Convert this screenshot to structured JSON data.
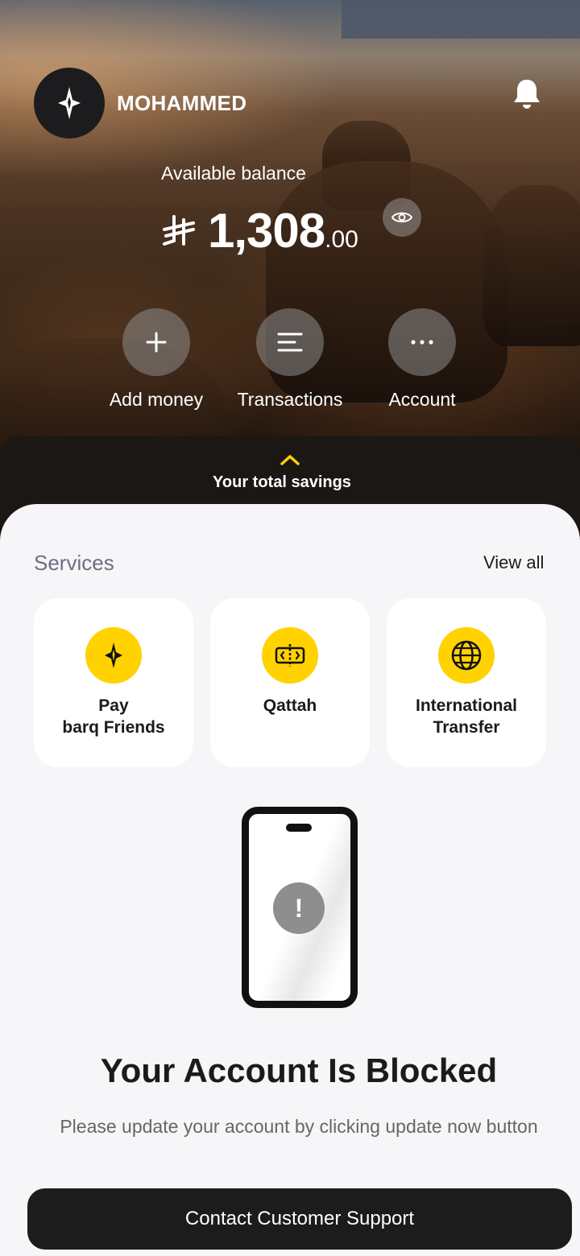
{
  "header": {
    "username": "MOHAMMED",
    "avatar_icon": "barq-sparkle-icon",
    "notification_icon": "bell-icon"
  },
  "balance": {
    "label": "Available balance",
    "currency_icon": "saudi-riyal-icon",
    "integer": "1,308",
    "decimal": ".00",
    "toggle_icon": "eye-icon"
  },
  "actions": [
    {
      "label": "Add money",
      "icon": "plus-icon"
    },
    {
      "label": "Transactions",
      "icon": "list-icon"
    },
    {
      "label": "Account",
      "icon": "more-dots-icon"
    }
  ],
  "savings": {
    "label": "Your total savings",
    "chevron_color": "#ffd200"
  },
  "services": {
    "title": "Services",
    "view_all": "View all",
    "items": [
      {
        "label": "Pay\nbarq Friends",
        "icon": "barq-sparkle-icon"
      },
      {
        "label": "Qattah",
        "icon": "split-bill-icon"
      },
      {
        "label": "International\nTransfer",
        "icon": "globe-icon"
      }
    ],
    "accent_color": "#ffd200"
  },
  "blocked": {
    "alert_symbol": "!",
    "title": "Your Account Is Blocked",
    "message": "Please update your account by clicking update now button",
    "button_label": "Contact Customer Support"
  }
}
